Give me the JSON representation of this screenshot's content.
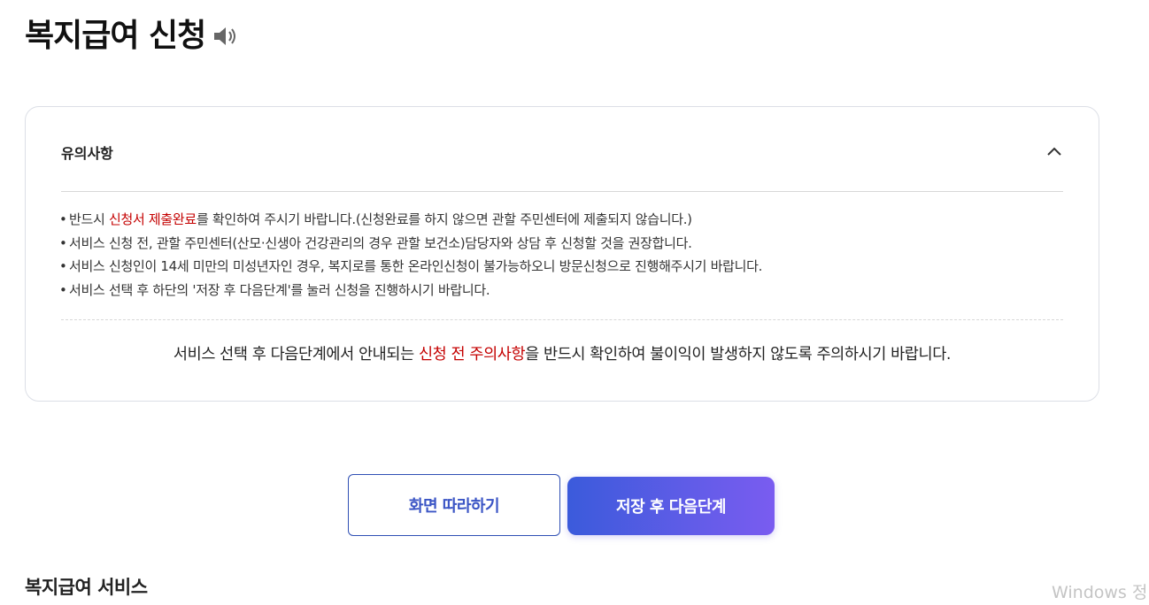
{
  "page": {
    "title": "복지급여 신청"
  },
  "notice": {
    "title": "유의사항",
    "items": [
      {
        "before": "반드시 ",
        "highlight": "신청서 제출완료",
        "after": "를 확인하여 주시기 바랍니다.(신청완료를 하지 않으면 관할 주민센터에 제출되지 않습니다.)"
      },
      {
        "before": "서비스 신청 전, 관할 주민센터(산모·신생아 건강관리의 경우 관할 보건소)담당자와 상담 후 신청할 것을 권장합니다.",
        "highlight": "",
        "after": ""
      },
      {
        "before": "서비스 신청인이 14세 미만의 미성년자인 경우, 복지로를 통한 온라인신청이 불가능하오니 방문신청으로 진행해주시기 바랍니다.",
        "highlight": "",
        "after": ""
      },
      {
        "before": "서비스 선택 후 하단의 '저장 후 다음단계'를 눌러 신청을 진행하시기 바랍니다.",
        "highlight": "",
        "after": ""
      }
    ],
    "footer": {
      "before": "서비스 선택 후 다음단계에서 안내되는 ",
      "highlight": "신청 전 주의사항",
      "after": "을 반드시 확인하여 불이익이 발생하지 않도록 주의하시기 바랍니다."
    },
    "bullet": "•"
  },
  "buttons": {
    "follow_screen": "화면 따라하기",
    "save_next": "저장 후 다음단계"
  },
  "section": {
    "title": "복지급여 서비스"
  },
  "os_watermark": "Windows 정",
  "icons": {
    "speaker": "speaker-icon",
    "chevron": "chevron-up-icon"
  },
  "colors": {
    "highlight_red": "#c40000",
    "primary_gradient_start": "#3b5bdb",
    "primary_gradient_end": "#7a5cf0",
    "outline_border": "#2f4fb4"
  }
}
